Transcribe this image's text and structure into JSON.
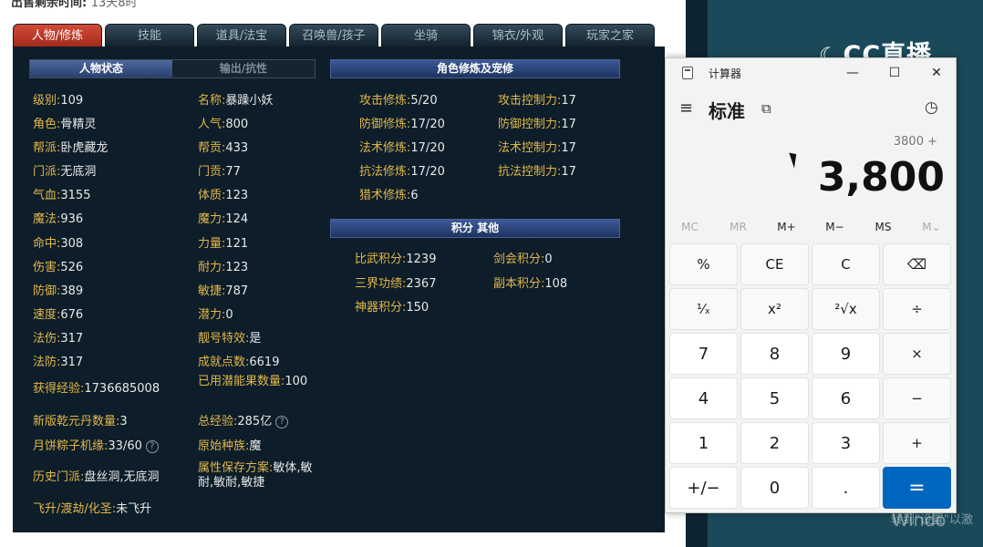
{
  "header": {
    "cut_text": "出售剩余时间:",
    "cut_value": "13天8时"
  },
  "tabs": [
    "人物/修炼",
    "技能",
    "道具/法宝",
    "召唤兽/孩子",
    "坐骑",
    "锦衣/外观",
    "玩家之家"
  ],
  "subtabs": [
    "人物状态",
    "输出/抗性"
  ],
  "left_col": [
    {
      "k": "级别:",
      "v": "109"
    },
    {
      "k": "角色:",
      "v": "骨精灵"
    },
    {
      "k": "帮派:",
      "v": "卧虎藏龙"
    },
    {
      "k": "门派:",
      "v": "无底洞"
    },
    {
      "k": "气血:",
      "v": "3155"
    },
    {
      "k": "魔法:",
      "v": "936"
    },
    {
      "k": "命中:",
      "v": "308"
    },
    {
      "k": "伤害:",
      "v": "526"
    },
    {
      "k": "防御:",
      "v": "389"
    },
    {
      "k": "速度:",
      "v": "676"
    },
    {
      "k": "法伤:",
      "v": "317"
    },
    {
      "k": "法防:",
      "v": "317"
    },
    {
      "k": "获得经验:",
      "v": "1736685008"
    },
    {
      "k": "新版乾元丹数量:",
      "v": "3"
    },
    {
      "k": "月饼粽子机缘:",
      "v": "33/60"
    },
    {
      "k": "历史门派:",
      "v": "盘丝洞,无底洞"
    },
    {
      "k": "飞升/渡劫/化圣:",
      "v": "未飞升"
    }
  ],
  "mid_col": [
    {
      "k": "名称:",
      "v": "暴躁小妖"
    },
    {
      "k": "人气:",
      "v": "800"
    },
    {
      "k": "帮贡:",
      "v": "433"
    },
    {
      "k": "门贡:",
      "v": "77"
    },
    {
      "k": "体质:",
      "v": "123"
    },
    {
      "k": "魔力:",
      "v": "124"
    },
    {
      "k": "力量:",
      "v": "121"
    },
    {
      "k": "耐力:",
      "v": "123"
    },
    {
      "k": "敏捷:",
      "v": "787"
    },
    {
      "k": "潜力:",
      "v": "0"
    },
    {
      "k": "靓号特效:",
      "v": "是"
    },
    {
      "k": "成就点数:",
      "v": "6619"
    },
    {
      "k": "已用潜能果数量:",
      "v": "100"
    },
    {
      "k": "总经验:",
      "v": "285亿"
    },
    {
      "k": "原始种族:",
      "v": "魔"
    },
    {
      "k": "属性保存方案:",
      "v": "敏体,敏耐,敏耐,敏捷"
    }
  ],
  "cultivation": {
    "title": "角色修炼及宠修",
    "left": [
      {
        "k": "攻击修炼:",
        "v": "5/20"
      },
      {
        "k": "防御修炼:",
        "v": "17/20"
      },
      {
        "k": "法术修炼:",
        "v": "17/20"
      },
      {
        "k": "抗法修炼:",
        "v": "17/20"
      },
      {
        "k": "猎术修炼:",
        "v": "6"
      }
    ],
    "right": [
      {
        "k": "攻击控制力:",
        "v": "17"
      },
      {
        "k": "防御控制力:",
        "v": "17"
      },
      {
        "k": "法术控制力:",
        "v": "17"
      },
      {
        "k": "抗法控制力:",
        "v": "17"
      }
    ]
  },
  "points": {
    "title": "积分 其他",
    "left": [
      {
        "k": "比武积分:",
        "v": "1239"
      },
      {
        "k": "三界功绩:",
        "v": "2367"
      },
      {
        "k": "神器积分:",
        "v": "150"
      }
    ],
    "right": [
      {
        "k": "剑会积分:",
        "v": "0"
      },
      {
        "k": "副本积分:",
        "v": "108"
      }
    ]
  },
  "brand": {
    "logo": "☾",
    "text": "CC直播"
  },
  "watermark": {
    "line1": "激活 Windo",
    "line2": "转到\"设置\"以激"
  },
  "calculator": {
    "title": "计算器",
    "win_buttons": [
      "—",
      "☐",
      "✕"
    ],
    "menu_icon": "≡",
    "mode": "标准",
    "keep_on_top_icon": "⧉",
    "history_icon": "◷",
    "expression": "3800 +",
    "display": "3,800",
    "memory": [
      {
        "label": "MC",
        "enabled": false
      },
      {
        "label": "MR",
        "enabled": false
      },
      {
        "label": "M+",
        "enabled": true
      },
      {
        "label": "M−",
        "enabled": true
      },
      {
        "label": "MS",
        "enabled": true
      },
      {
        "label": "M⌄",
        "enabled": false
      }
    ],
    "keys": [
      {
        "label": "%",
        "name": "percent-key"
      },
      {
        "label": "CE",
        "name": "clear-entry-key"
      },
      {
        "label": "C",
        "name": "clear-key"
      },
      {
        "label": "⌫",
        "name": "backspace-key"
      },
      {
        "label": "¹⁄ₓ",
        "name": "reciprocal-key"
      },
      {
        "label": "x²",
        "name": "square-key"
      },
      {
        "label": "²√x",
        "name": "sqrt-key"
      },
      {
        "label": "÷",
        "name": "divide-key"
      },
      {
        "label": "7",
        "name": "key-7",
        "num": true
      },
      {
        "label": "8",
        "name": "key-8",
        "num": true
      },
      {
        "label": "9",
        "name": "key-9",
        "num": true
      },
      {
        "label": "×",
        "name": "multiply-key"
      },
      {
        "label": "4",
        "name": "key-4",
        "num": true
      },
      {
        "label": "5",
        "name": "key-5",
        "num": true
      },
      {
        "label": "6",
        "name": "key-6",
        "num": true
      },
      {
        "label": "−",
        "name": "subtract-key"
      },
      {
        "label": "1",
        "name": "key-1",
        "num": true
      },
      {
        "label": "2",
        "name": "key-2",
        "num": true
      },
      {
        "label": "3",
        "name": "key-3",
        "num": true
      },
      {
        "label": "+",
        "name": "add-key"
      },
      {
        "label": "+/−",
        "name": "negate-key",
        "num": true
      },
      {
        "label": "0",
        "name": "key-0",
        "num": true
      },
      {
        "label": ".",
        "name": "decimal-key",
        "num": true
      },
      {
        "label": "=",
        "name": "equals-key",
        "eq": true
      }
    ]
  },
  "colors": {
    "panel_bg": "#0d1e2a",
    "label": "#e2b64a",
    "value": "#e8e8e8",
    "active_tab": "#d24a38",
    "equals": "#0067c0"
  }
}
